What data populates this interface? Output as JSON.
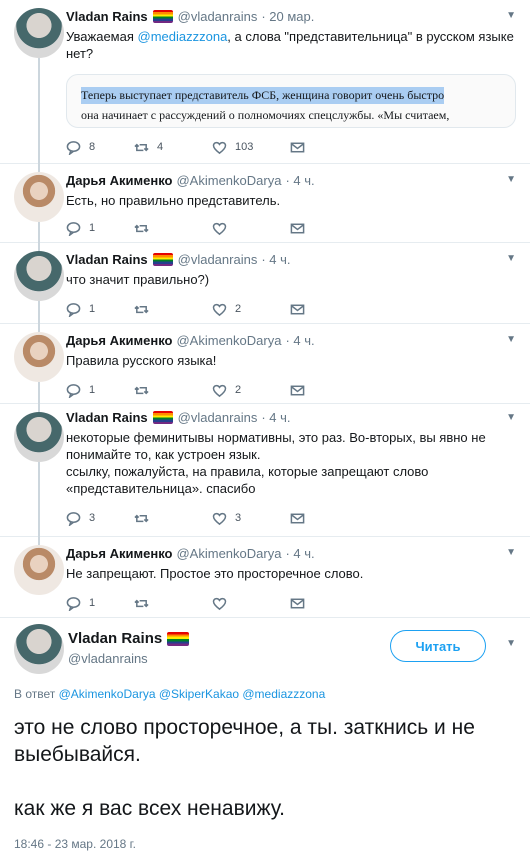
{
  "tweets": [
    {
      "author": "vladan",
      "name": "Vladan Rains",
      "handle": "@vladanrains",
      "time": "· 20 мар.",
      "text_before": "Уважаемая ",
      "mention": "@mediazzzona",
      "text_after": ", а слова \"представительница\" в русском языке нет?",
      "quote_line1": "Теперь выступает представитель ФСБ, женщина говорит очень быстро",
      "quote_line2": "она начинает с рассуждений о полномочиях спецслужбы. «Мы считаем,",
      "replies": "8",
      "retweets": "4",
      "likes": "103"
    },
    {
      "author": "darya",
      "name": "Дарья Акименко",
      "handle": "@AkimenkoDarya",
      "time": "· 4 ч.",
      "text": "Есть, но правильно представитель.",
      "replies": "1",
      "retweets": "",
      "likes": ""
    },
    {
      "author": "vladan",
      "name": "Vladan Rains",
      "handle": "@vladanrains",
      "time": "· 4 ч.",
      "text": "что значит правильно?)",
      "replies": "1",
      "retweets": "",
      "likes": "2"
    },
    {
      "author": "darya",
      "name": "Дарья Акименко",
      "handle": "@AkimenkoDarya",
      "time": "· 4 ч.",
      "text": "Правила русского языка!",
      "replies": "1",
      "retweets": "",
      "likes": "2"
    },
    {
      "author": "vladan",
      "name": "Vladan Rains",
      "handle": "@vladanrains",
      "time": "· 4 ч.",
      "text": "некоторые феминитывы нормативны, это раз. Во-вторых, вы явно не понимайте то, как устроен язык.",
      "text2": "ссылку, пожалуйста, на правила, которые запрещают слово «представительница». спасибо",
      "replies": "3",
      "retweets": "",
      "likes": "3"
    },
    {
      "author": "darya",
      "name": "Дарья Акименко",
      "handle": "@AkimenkoDarya",
      "time": "· 4 ч.",
      "text": "Не запрещают. Простое это просторечное слово.",
      "replies": "1",
      "retweets": "",
      "likes": ""
    }
  ],
  "main": {
    "name": "Vladan Rains",
    "handle": "@vladanrains",
    "follow_label": "Читать",
    "reply_prefix": "В ответ",
    "reply_mentions": "@AkimenkoDarya @SkiperKakao @mediazzzona",
    "text_line1": "это не слово просторечное, а ты. заткнись и не выебывайся.",
    "text_line2": "как же я вас всех ненавижу.",
    "timestamp": "18:46 - 23 мар. 2018 г."
  },
  "icons": {
    "reply": "reply-icon",
    "retweet": "retweet-icon",
    "like": "heart-icon",
    "dm": "envelope-icon",
    "more": "chevron-down-icon",
    "flag": "rainbow-flag-icon"
  },
  "colors": {
    "accent": "#1da1f2",
    "mention": "#1b95e0",
    "muted": "#657786",
    "highlight": "#aacdf2"
  }
}
